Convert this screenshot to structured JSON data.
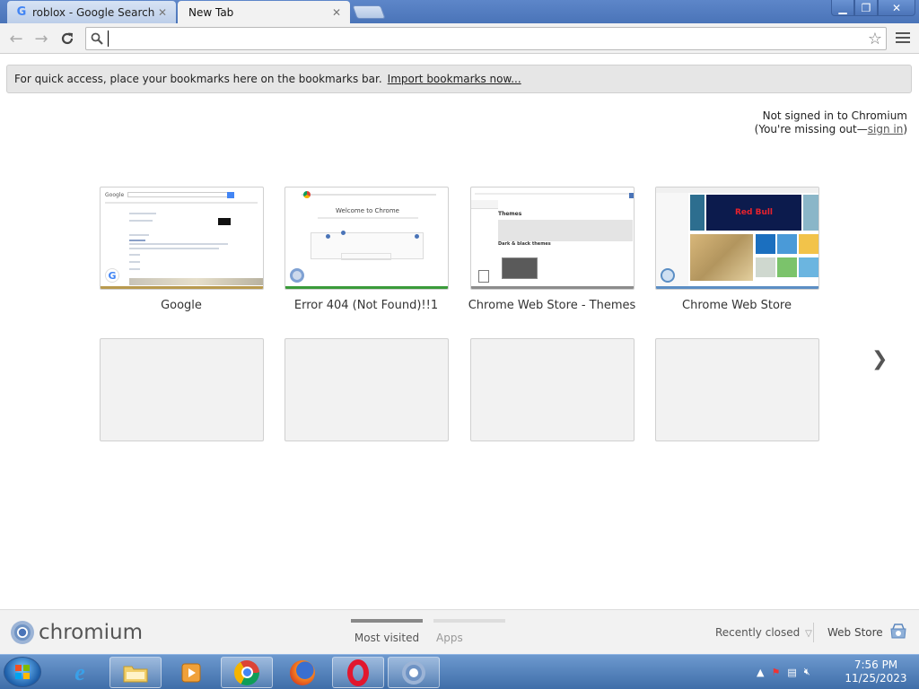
{
  "tabs": [
    {
      "title": "roblox - Google Search",
      "active": false,
      "favicon": "google-g-icon"
    },
    {
      "title": "New Tab",
      "active": true
    }
  ],
  "window_controls": {
    "minimize": "minimize-icon",
    "maximize": "maximize-icon",
    "close": "close-icon"
  },
  "toolbar": {
    "omnibox_value": "",
    "omnibox_placeholder": ""
  },
  "bookmark_bar": {
    "message": "For quick access, place your bookmarks here on the bookmarks bar.",
    "import_link": "Import bookmarks now..."
  },
  "signin": {
    "line1": "Not signed in to Chromium",
    "line2_prefix": "(You're missing out—",
    "line2_link": "sign in",
    "line2_suffix": ")"
  },
  "most_visited": [
    {
      "title": "Google",
      "stripe_color": "#b99a4e"
    },
    {
      "title": "Error 404 (Not Found)!!1",
      "stripe_color": "#3a9b3a"
    },
    {
      "title": "Chrome Web Store - Themes",
      "stripe_color": "#8c8c8c"
    },
    {
      "title": "Chrome Web Store",
      "stripe_color": "#5b8ec4"
    }
  ],
  "thumb_text": {
    "welcome": "Welcome to Chrome",
    "themes_heading": "Themes",
    "themes_dark": "Dark & black themes",
    "redbull": "Red Bull"
  },
  "footer": {
    "brand": "chromium",
    "tabs": [
      {
        "label": "Most visited",
        "active": true
      },
      {
        "label": "Apps",
        "active": false
      }
    ],
    "recently_closed": "Recently closed",
    "web_store": "Web Store"
  },
  "clock": {
    "time": "7:56 PM",
    "date": "11/25/2023"
  },
  "colors": {
    "accent_blue": "#4a74b8",
    "tile_empty": "#f2f2f2"
  }
}
